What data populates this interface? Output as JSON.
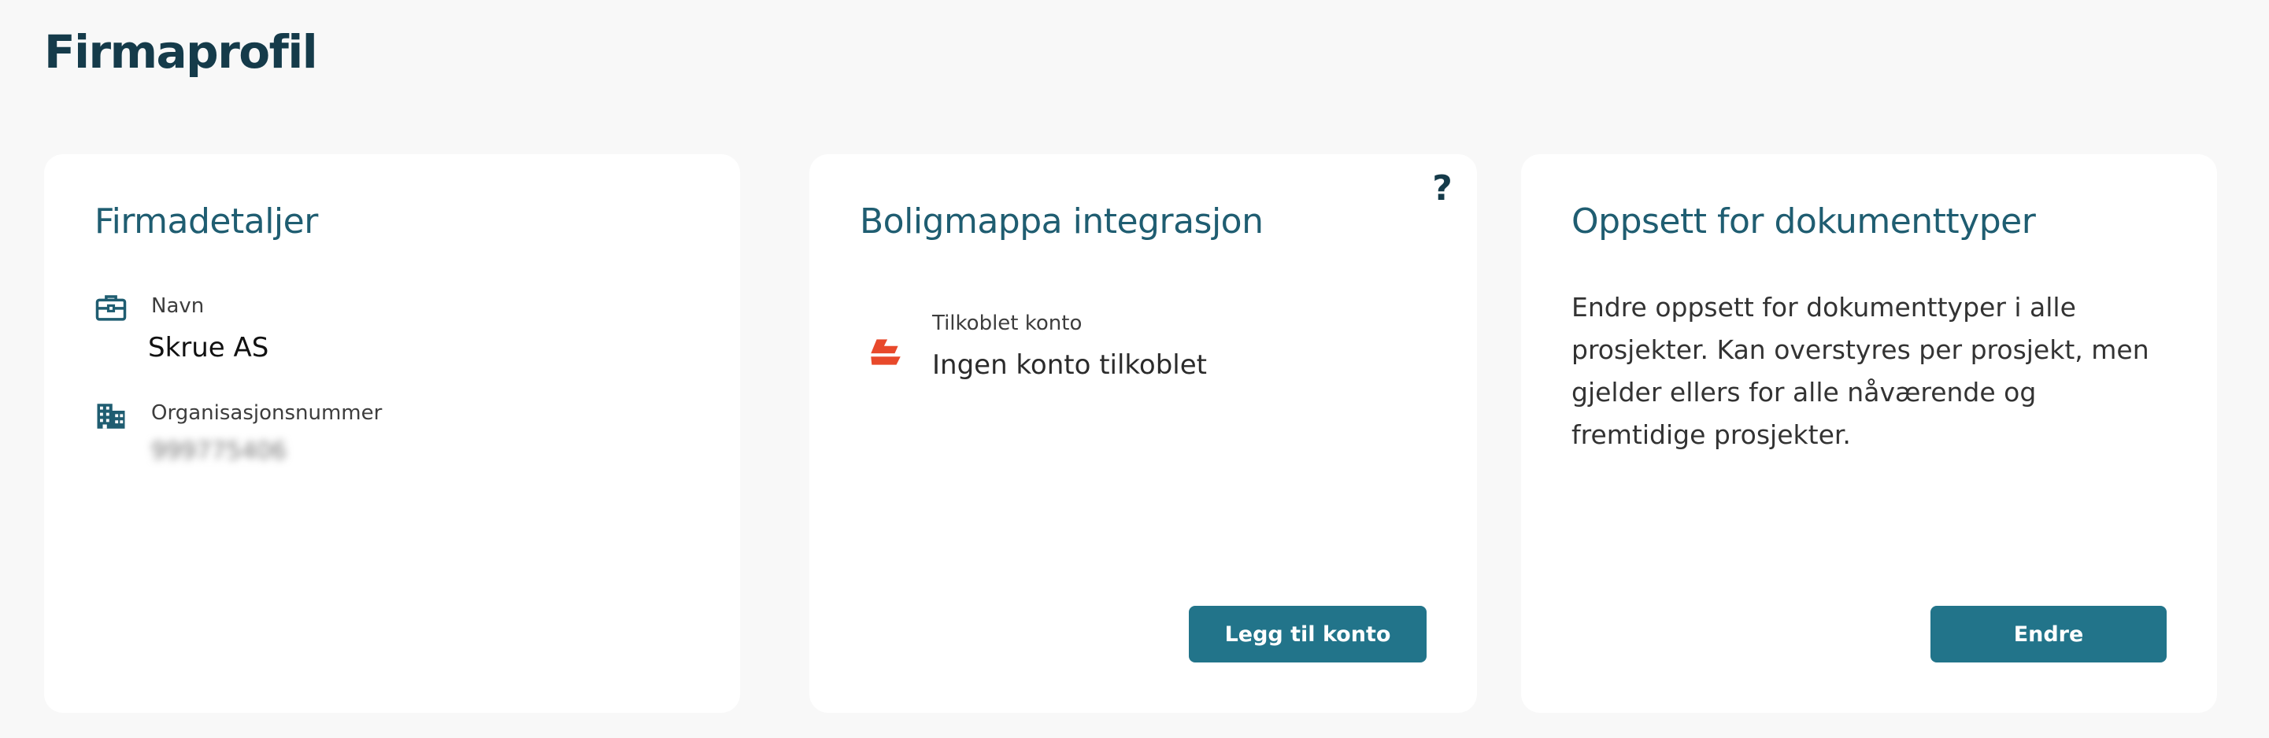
{
  "page": {
    "title": "Firmaprofil"
  },
  "company_details": {
    "title": "Firmadetaljer",
    "name_label": "Navn",
    "name_value": "Skrue AS",
    "orgnr_label": "Organisasjonsnummer",
    "orgnr_value": "999775406",
    "name_icon": "briefcase-icon",
    "orgnr_icon": "building-icon"
  },
  "boligmappa": {
    "title": "Boligmappa integrasjon",
    "help_label": "?",
    "account_label": "Tilkoblet konto",
    "account_value": "Ingen konto tilkoblet",
    "account_icon": "boligmappa-logo-icon",
    "button_label": "Legg til konto"
  },
  "document_types": {
    "title": "Oppsett for dokumenttyper",
    "description": "Endre oppsett for dokumenttyper i alle prosjekter. Kan overstyres per prosjekt, men gjelder ellers for alle nåværende og fremtidige prosjekter.",
    "button_label": "Endre"
  },
  "colors": {
    "background": "#f8f8f8",
    "heading": "#153b4a",
    "card_title": "#1f5d71",
    "button": "#22748a",
    "logo": "#e8492b"
  }
}
